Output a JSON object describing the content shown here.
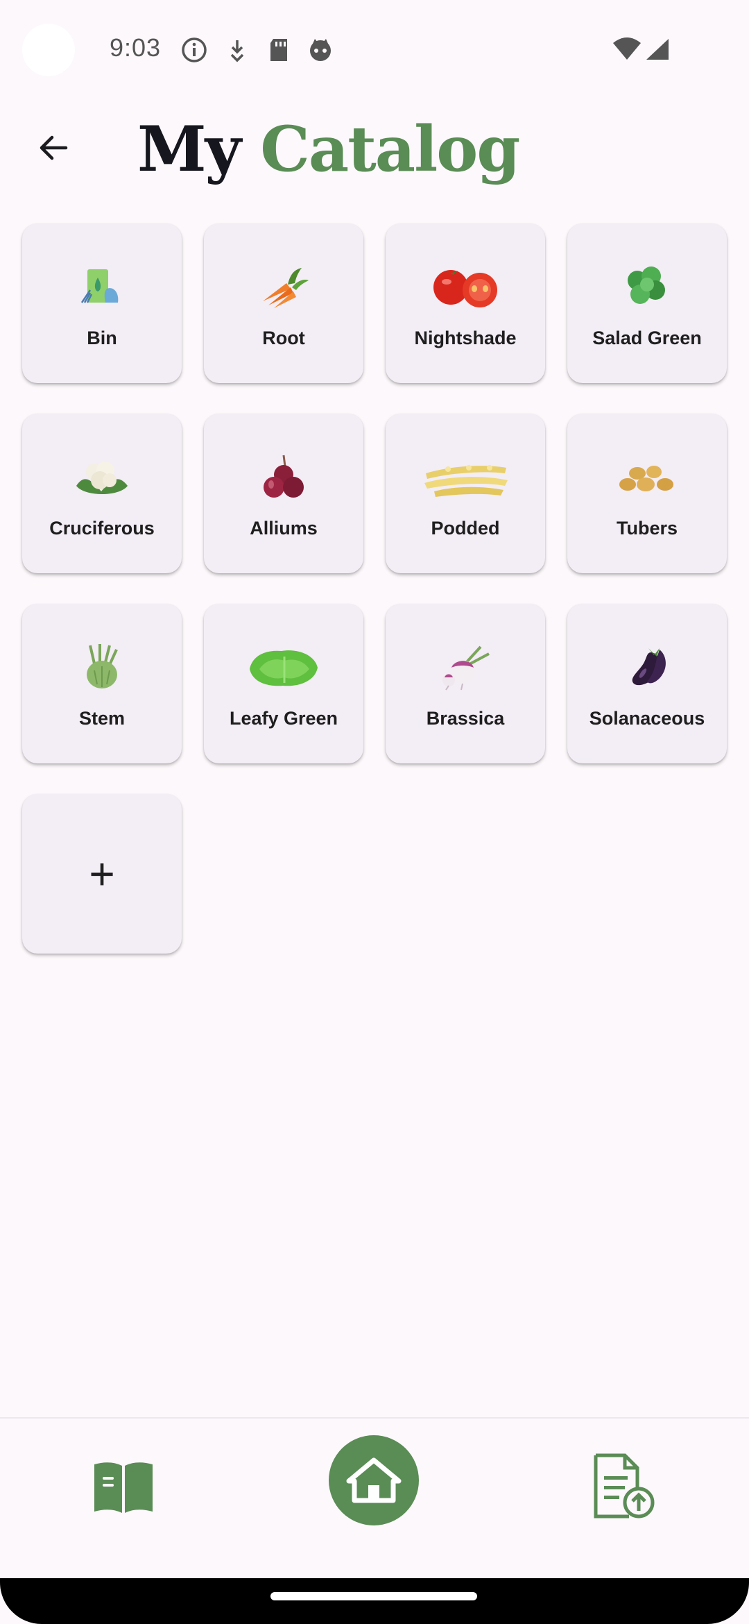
{
  "status_bar": {
    "time": "9:03",
    "icons": [
      "info-icon",
      "download-arrow-icon",
      "sd-card-icon",
      "cat-face-icon"
    ],
    "right_icons": [
      "wifi-icon",
      "cell-signal-icon"
    ]
  },
  "header": {
    "title_part1": "My",
    "title_part2": "Catalog",
    "back_icon": "arrow-left-icon"
  },
  "categories": [
    {
      "label": "Bin",
      "icon": "bin-icon"
    },
    {
      "label": "Root",
      "icon": "carrot-icon"
    },
    {
      "label": "Nightshade",
      "icon": "tomato-icon"
    },
    {
      "label": "Salad Green",
      "icon": "salad-icon"
    },
    {
      "label": "Cruciferous",
      "icon": "cauliflower-icon"
    },
    {
      "label": "Alliums",
      "icon": "onion-icon"
    },
    {
      "label": "Podded",
      "icon": "pods-icon"
    },
    {
      "label": "Tubers",
      "icon": "potato-icon"
    },
    {
      "label": "Stem",
      "icon": "kohlrabi-icon"
    },
    {
      "label": "Leafy Green",
      "icon": "lettuce-icon"
    },
    {
      "label": "Brassica",
      "icon": "turnip-icon"
    },
    {
      "label": "Solanaceous",
      "icon": "eggplant-icon"
    }
  ],
  "add_card": {
    "label": "+"
  },
  "bottom_nav": {
    "items": [
      "catalog-book-icon",
      "home-icon",
      "upload-document-icon"
    ]
  },
  "colors": {
    "accent": "#5a8c55",
    "background": "#fcf8fb",
    "card": "#f3edf5"
  }
}
